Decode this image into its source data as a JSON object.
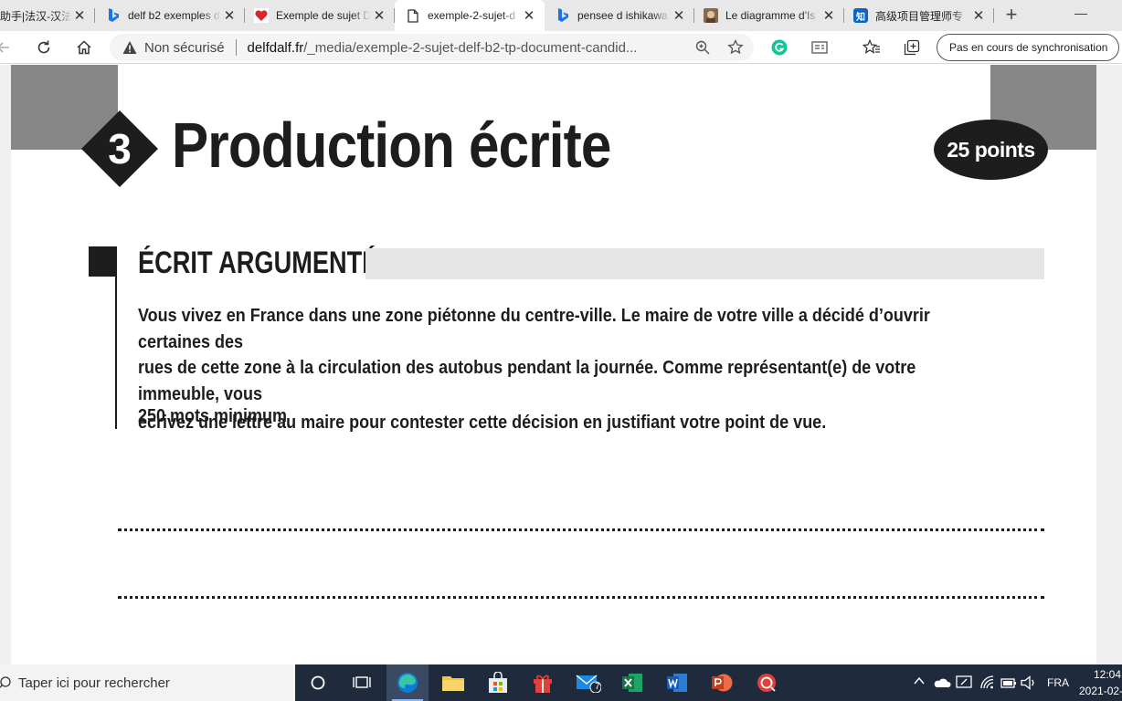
{
  "browser": {
    "tabs": [
      {
        "title": "助手|法汉-汉法",
        "favicon": "none",
        "active": false
      },
      {
        "title": "delf b2 exemples d",
        "favicon": "bing-icon",
        "active": false
      },
      {
        "title": "Exemple de sujet D",
        "favicon": "heart-icon",
        "active": false
      },
      {
        "title": "exemple-2-sujet-d",
        "favicon": "document-icon",
        "active": true
      },
      {
        "title": "pensee d ishikawa",
        "favicon": "bing-icon",
        "active": false
      },
      {
        "title": "Le diagramme d'Is",
        "favicon": "photo-icon",
        "active": false
      },
      {
        "title": "高级项目管理师专",
        "favicon": "zhihu-icon",
        "active": false
      }
    ],
    "zhihu_label": "知",
    "security_label": "Non sécurisé",
    "url_host": "delfdalf.fr",
    "url_path": "/_media/exemple-2-sujet-delf-b2-tp-document-candid...",
    "sync_label": "Pas en cours de synchronisation"
  },
  "document": {
    "section_number": "3",
    "section_title": "Production écrite",
    "points": "25 points",
    "subsection_title": "ÉCRIT ARGUMENTÉ",
    "prompt_lines": [
      "Vous vivez en France dans une zone piétonne du centre-ville. Le maire de votre ville a décidé d’ouvrir certaines des",
      "rues de cette zone à la circulation des autobus pendant la journée. Comme représentant(e) de votre immeuble, vous",
      "écrivez une lettre au maire pour contester cette décision en justifiant votre point de vue."
    ],
    "word_count": "250 mots minimum"
  },
  "taskbar": {
    "search_placeholder": "Taper ici pour rechercher",
    "mail_badge": "7",
    "language": "FRA",
    "time": "12:04",
    "date": "2021-02-"
  },
  "colors": {
    "ink": "#1d1d1d",
    "header_grey": "#878787",
    "bar_grey": "#e5e5e5",
    "taskbar": "#1f2b3d"
  }
}
